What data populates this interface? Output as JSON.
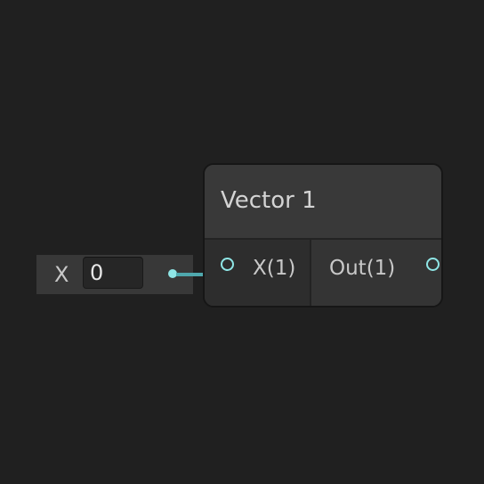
{
  "inline_input": {
    "label": "X",
    "value": "0"
  },
  "node": {
    "title": "Vector 1",
    "input_port": {
      "label": "X(1)"
    },
    "output_port": {
      "label": "Out(1)"
    }
  },
  "colors": {
    "background": "#202020",
    "node_body": "#393939",
    "port_accent": "#8fe6e6",
    "edge": "#4fa8ad"
  }
}
